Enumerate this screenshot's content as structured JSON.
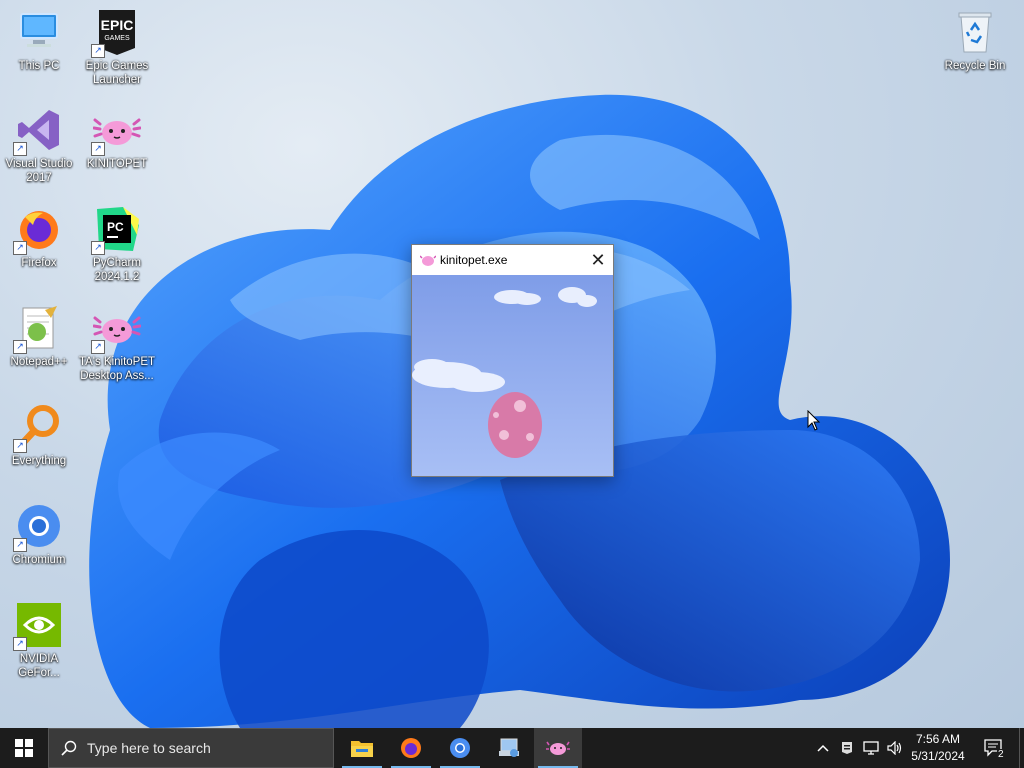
{
  "desktop": {
    "icons": [
      {
        "id": "this-pc",
        "label": "This PC"
      },
      {
        "id": "epic",
        "label": "Epic Games Launcher",
        "logo_text": "EPIC",
        "logo_sub": "GAMES"
      },
      {
        "id": "vs",
        "label": "Visual Studio 2017"
      },
      {
        "id": "kinitopet",
        "label": "KINITOPET"
      },
      {
        "id": "firefox",
        "label": "Firefox"
      },
      {
        "id": "pycharm",
        "label": "PyCharm 2024.1.2",
        "logo_text": "PC"
      },
      {
        "id": "notepadpp",
        "label": "Notepad++"
      },
      {
        "id": "ta-kinitopet",
        "label": "TA's KinitoPET Desktop Ass..."
      },
      {
        "id": "everything",
        "label": "Everything"
      },
      {
        "id": "chromium",
        "label": "Chromium"
      },
      {
        "id": "nvidia",
        "label": "NVIDIA GeFor..."
      },
      {
        "id": "recycle",
        "label": "Recycle Bin"
      }
    ]
  },
  "window": {
    "title": "kinitopet.exe",
    "close_glyph": "✕"
  },
  "taskbar": {
    "search_placeholder": "Type here to search",
    "apps": [
      "file-explorer",
      "firefox",
      "chromium",
      "control-panel",
      "kinitopet"
    ],
    "active_app": "kinitopet",
    "clock": {
      "time": "7:56 AM",
      "date": "5/31/2024"
    },
    "notifications_count": "2",
    "tray_chevron": "^"
  },
  "colors": {
    "taskbar_bg": "#1c1c1c",
    "accent": "#76b9ed",
    "wallpaper_blue": "#1a5de0"
  }
}
